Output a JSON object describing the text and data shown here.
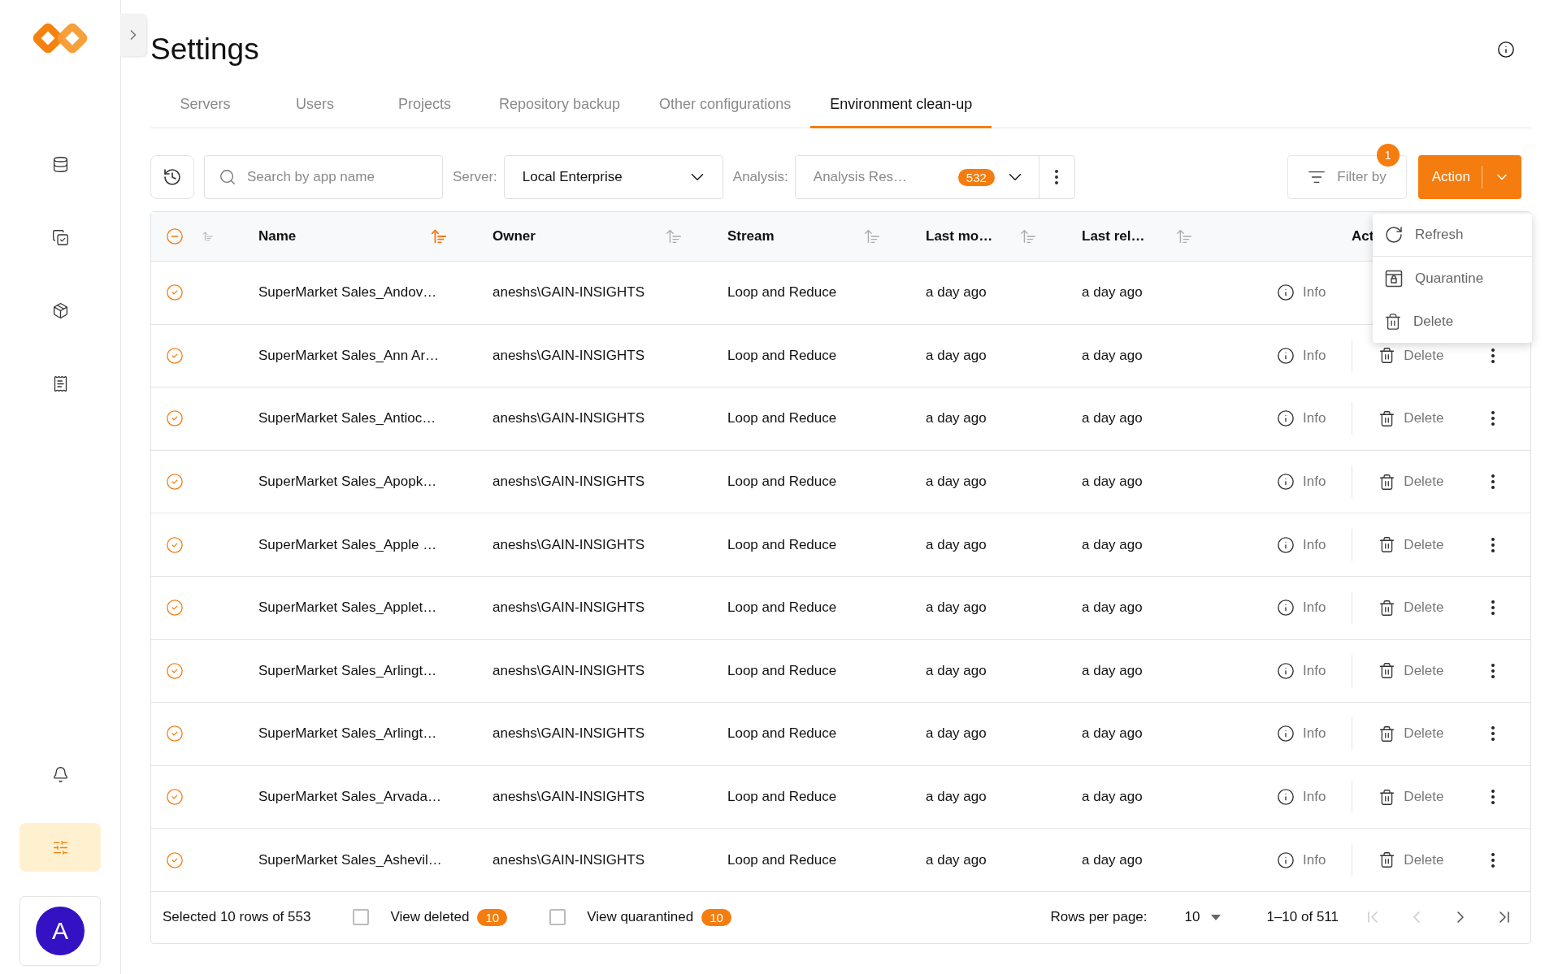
{
  "sidebar": {
    "top_items": [
      {
        "kind": "database",
        "selected": false
      },
      {
        "kind": "checks",
        "selected": false
      },
      {
        "kind": "package",
        "selected": false
      },
      {
        "kind": "report",
        "selected": false
      }
    ],
    "bottom_items": [
      {
        "kind": "bell",
        "selected": false
      },
      {
        "kind": "settings",
        "selected": true
      }
    ],
    "avatar": "A"
  },
  "page": {
    "title": "Settings"
  },
  "tabs": [
    {
      "label": "Servers",
      "selected": false
    },
    {
      "label": "Users",
      "selected": false
    },
    {
      "label": "Projects",
      "selected": false
    },
    {
      "label": "Repository backup",
      "selected": false
    },
    {
      "label": "Other configurations",
      "selected": false
    },
    {
      "label": "Environment clean-up",
      "selected": true
    }
  ],
  "toolbar": {
    "search": {
      "placeholder": "Search by app name"
    },
    "server": {
      "label": "Server:",
      "value": "Local Enterprise"
    },
    "analysis": {
      "label": "Analysis:",
      "value": "Analysis Res…",
      "badge": "532"
    },
    "filter": {
      "label": "Filter by",
      "badge": "1"
    },
    "action": {
      "label": "Action"
    }
  },
  "table": {
    "columns": [
      {
        "kind": "check",
        "indeterminate": true,
        "sorted": false
      },
      {
        "kind": "text",
        "label": "Name",
        "sorted": true
      },
      {
        "kind": "text",
        "label": "Owner",
        "sorted": false
      },
      {
        "kind": "text",
        "label": "Stream",
        "sorted": false
      },
      {
        "kind": "text",
        "label": "Last mo…",
        "sorted": false
      },
      {
        "kind": "text",
        "label": "Last rel…",
        "sorted": false
      },
      {
        "kind": "actions",
        "label": "Act"
      }
    ],
    "rows": [
      {
        "selected": true,
        "name": "SuperMarket Sales_Andov…",
        "owner": "aneshs\\GAIN-INSIGHTS",
        "stream": "Loop and Reduce",
        "last_modified": "a day ago",
        "last_reloaded": "a day ago",
        "actions": [
          {
            "kind": "info",
            "label": "Info"
          }
        ]
      },
      {
        "selected": true,
        "name": "SuperMarket Sales_Ann Ar…",
        "owner": "aneshs\\GAIN-INSIGHTS",
        "stream": "Loop and Reduce",
        "last_modified": "a day ago",
        "last_reloaded": "a day ago",
        "actions": [
          {
            "kind": "info",
            "label": "Info"
          },
          {
            "kind": "delete",
            "label": "Delete"
          },
          {
            "kind": "more"
          }
        ]
      },
      {
        "selected": true,
        "name": "SuperMarket Sales_Antioc…",
        "owner": "aneshs\\GAIN-INSIGHTS",
        "stream": "Loop and Reduce",
        "last_modified": "a day ago",
        "last_reloaded": "a day ago",
        "actions": [
          {
            "kind": "info",
            "label": "Info"
          },
          {
            "kind": "delete",
            "label": "Delete"
          },
          {
            "kind": "more"
          }
        ]
      },
      {
        "selected": true,
        "name": "SuperMarket Sales_Apopk…",
        "owner": "aneshs\\GAIN-INSIGHTS",
        "stream": "Loop and Reduce",
        "last_modified": "a day ago",
        "last_reloaded": "a day ago",
        "actions": [
          {
            "kind": "info",
            "label": "Info"
          },
          {
            "kind": "delete",
            "label": "Delete"
          },
          {
            "kind": "more"
          }
        ]
      },
      {
        "selected": true,
        "name": "SuperMarket Sales_Apple …",
        "owner": "aneshs\\GAIN-INSIGHTS",
        "stream": "Loop and Reduce",
        "last_modified": "a day ago",
        "last_reloaded": "a day ago",
        "actions": [
          {
            "kind": "info",
            "label": "Info"
          },
          {
            "kind": "delete",
            "label": "Delete"
          },
          {
            "kind": "more"
          }
        ]
      },
      {
        "selected": true,
        "name": "SuperMarket Sales_Applet…",
        "owner": "aneshs\\GAIN-INSIGHTS",
        "stream": "Loop and Reduce",
        "last_modified": "a day ago",
        "last_reloaded": "a day ago",
        "actions": [
          {
            "kind": "info",
            "label": "Info"
          },
          {
            "kind": "delete",
            "label": "Delete"
          },
          {
            "kind": "more"
          }
        ]
      },
      {
        "selected": true,
        "name": "SuperMarket Sales_Arlingt…",
        "owner": "aneshs\\GAIN-INSIGHTS",
        "stream": "Loop and Reduce",
        "last_modified": "a day ago",
        "last_reloaded": "a day ago",
        "actions": [
          {
            "kind": "info",
            "label": "Info"
          },
          {
            "kind": "delete",
            "label": "Delete"
          },
          {
            "kind": "more"
          }
        ]
      },
      {
        "selected": true,
        "name": "SuperMarket Sales_Arlingt…",
        "owner": "aneshs\\GAIN-INSIGHTS",
        "stream": "Loop and Reduce",
        "last_modified": "a day ago",
        "last_reloaded": "a day ago",
        "actions": [
          {
            "kind": "info",
            "label": "Info"
          },
          {
            "kind": "delete",
            "label": "Delete"
          },
          {
            "kind": "more"
          }
        ]
      },
      {
        "selected": true,
        "name": "SuperMarket Sales_Arvada…",
        "owner": "aneshs\\GAIN-INSIGHTS",
        "stream": "Loop and Reduce",
        "last_modified": "a day ago",
        "last_reloaded": "a day ago",
        "actions": [
          {
            "kind": "info",
            "label": "Info"
          },
          {
            "kind": "delete",
            "label": "Delete"
          },
          {
            "kind": "more"
          }
        ]
      },
      {
        "selected": true,
        "name": "SuperMarket Sales_Ashevil…",
        "owner": "aneshs\\GAIN-INSIGHTS",
        "stream": "Loop and Reduce",
        "last_modified": "a day ago",
        "last_reloaded": "a day ago",
        "actions": [
          {
            "kind": "info",
            "label": "Info"
          },
          {
            "kind": "delete",
            "label": "Delete"
          },
          {
            "kind": "more"
          }
        ]
      }
    ],
    "footer": {
      "summary": "Selected 10 rows of 553",
      "toggles": [
        {
          "label": "View deleted",
          "checked": false,
          "badge": "10"
        },
        {
          "label": "View quarantined",
          "checked": false,
          "badge": "10"
        }
      ],
      "rows_per_page_label": "Rows per page:",
      "rows_per_page": "10",
      "range": "1–10 of 511",
      "pager": [
        {
          "kind": "first",
          "disabled": true
        },
        {
          "kind": "prev",
          "disabled": true
        },
        {
          "kind": "next",
          "disabled": false
        },
        {
          "kind": "last",
          "disabled": false
        }
      ]
    }
  },
  "action_menu": {
    "items": [
      {
        "kind": "refresh",
        "label": "Refresh"
      },
      {
        "kind": "quarantine",
        "label": "Quarantine"
      },
      {
        "kind": "delete",
        "label": "Delete"
      }
    ]
  }
}
